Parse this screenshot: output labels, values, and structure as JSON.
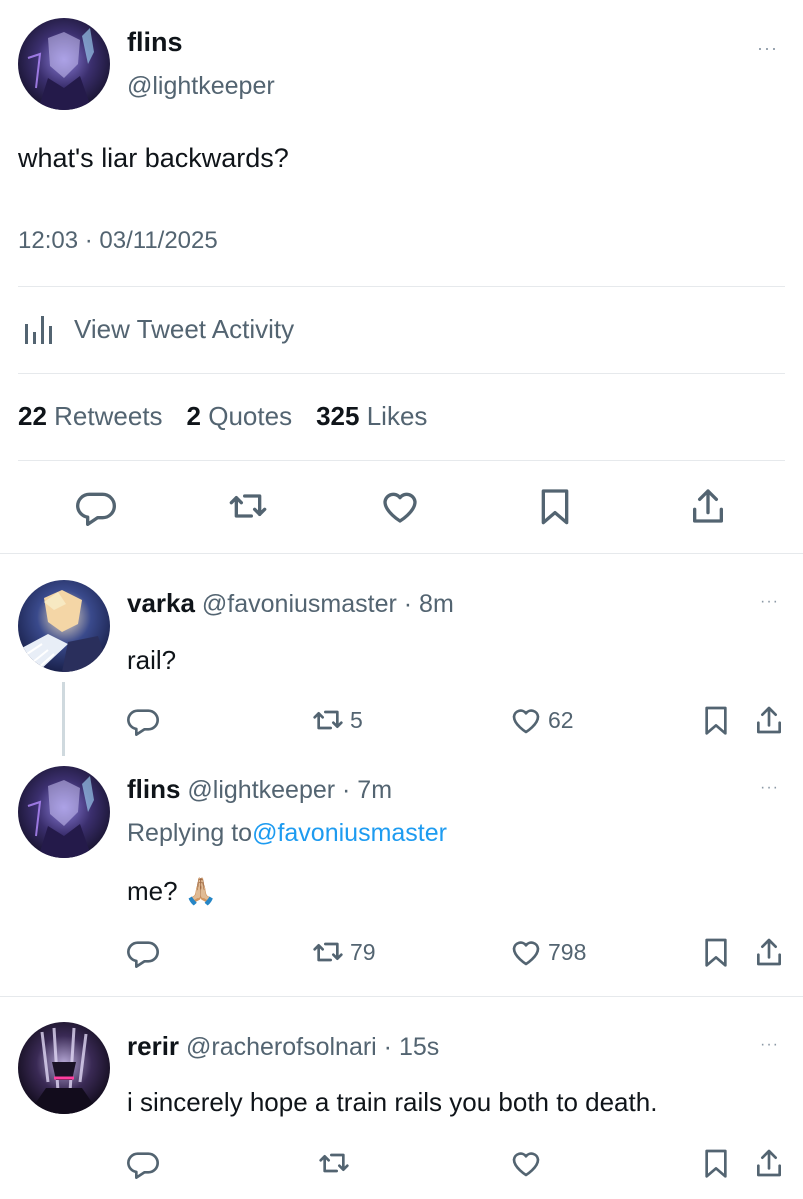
{
  "main_tweet": {
    "author_name": "flins",
    "author_handle": "@lightkeeper",
    "text": "what's liar backwards?",
    "timestamp": "12:03 · 03/11/2025",
    "activity_label": "View Tweet Activity",
    "stats": [
      {
        "count": "22",
        "label": "Retweets"
      },
      {
        "count": "2",
        "label": "Quotes"
      },
      {
        "count": "325",
        "label": "Likes"
      }
    ],
    "more_label": "···"
  },
  "replies": [
    {
      "author_name": "varka",
      "author_handle": "@favoniusmaster · 8m",
      "text": "rail?",
      "retweets": "5",
      "likes": "62",
      "more_label": "···"
    },
    {
      "author_name": "flins",
      "author_handle": "@lightkeeper · 7m",
      "replying_prefix": "Replying to",
      "replying_handle": "@favoniusmaster",
      "text": "me? 🙏🏼",
      "retweets": "79",
      "likes": "798",
      "more_label": "···"
    },
    {
      "author_name": "rerir",
      "author_handle": "@racherofsolnari · 15s",
      "text": "i sincerely hope a train rails you both to death.",
      "retweets": "",
      "likes": "",
      "more_label": "···"
    }
  ],
  "colors": {
    "text": "#0f1419",
    "secondary": "#536471",
    "link": "#1d9bf0",
    "divider": "#e6e9ec"
  }
}
